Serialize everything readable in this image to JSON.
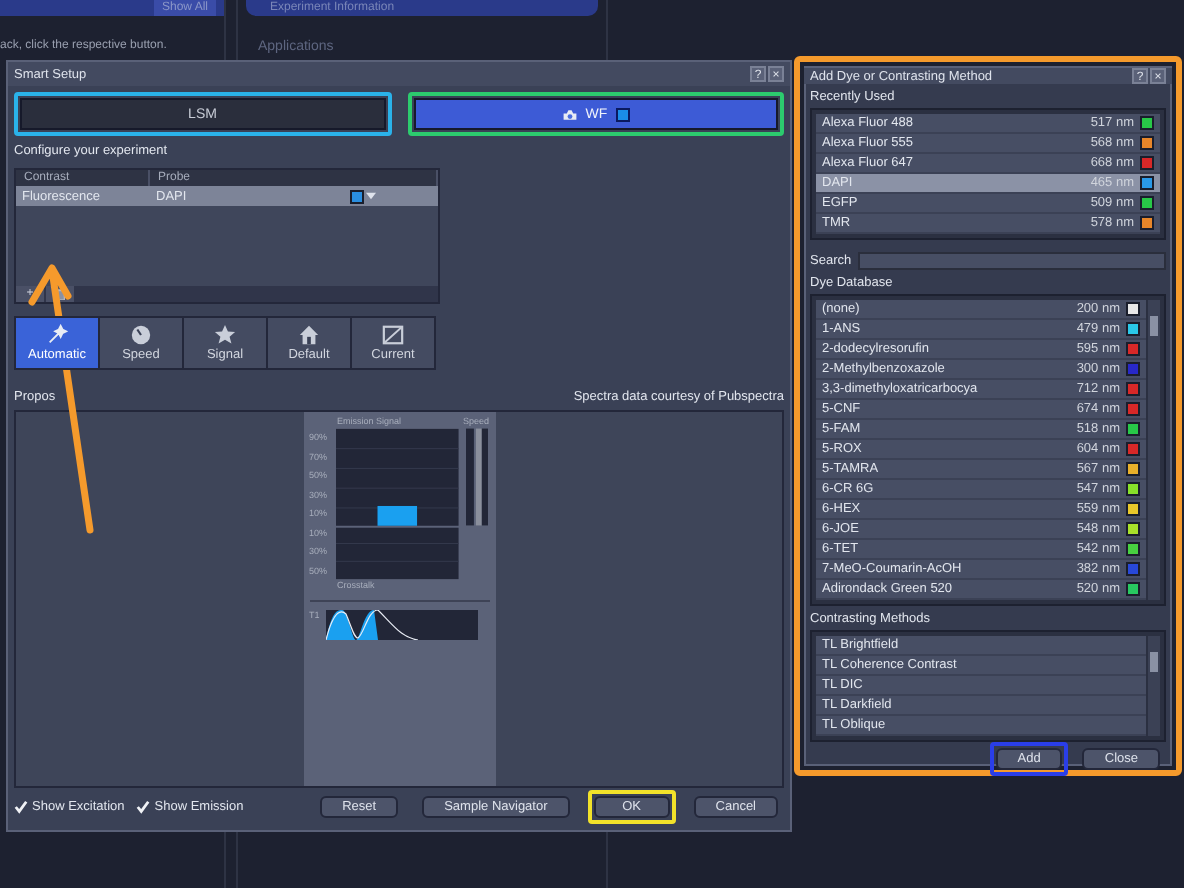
{
  "background": {
    "left_button": "Show All",
    "hint": "ack, click the respective button.",
    "section": "Experiment Information",
    "heading": "Applications"
  },
  "smart_setup": {
    "title": "Smart Setup",
    "help": "?",
    "close": "×",
    "tabs": [
      {
        "label": "LSM",
        "selected": false,
        "color": "#2ab2ea"
      },
      {
        "label": "WF",
        "selected": true,
        "color": "#2ccb6e"
      }
    ],
    "configure_label": "Configure your experiment",
    "table": {
      "columns": [
        "Contrast",
        "Probe"
      ],
      "rows": [
        {
          "contrast": "Fluorescence",
          "probe": "DAPI",
          "color": "#2a8ee0",
          "selected": true
        }
      ]
    },
    "add_row": "+",
    "modes": [
      {
        "label": "Automatic",
        "kind": "auto",
        "selected": true
      },
      {
        "label": "Speed",
        "kind": "clock",
        "selected": false
      },
      {
        "label": "Signal",
        "kind": "star",
        "selected": false
      },
      {
        "label": "Default",
        "kind": "house",
        "selected": false
      },
      {
        "label": "Current",
        "kind": "frame",
        "selected": false
      }
    ],
    "proposal_label": "Propos",
    "credit": "Spectra data courtesy of Pubspectra",
    "emission": {
      "title": "Emission Signal",
      "speed_label": "Speed",
      "ticks": [
        "90%",
        "70%",
        "50%",
        "30%",
        "10%",
        "10%",
        "30%",
        "50%"
      ],
      "crosstalk_label": "Crosstalk",
      "track": "T1"
    },
    "checkboxes": [
      {
        "label": "Show Excitation",
        "checked": true
      },
      {
        "label": "Show Emission",
        "checked": true
      }
    ],
    "buttons": [
      {
        "label": "Reset"
      },
      {
        "label": "Sample Navigator"
      },
      {
        "label": "OK",
        "color": "#f2e22a"
      },
      {
        "label": "Cancel"
      }
    ]
  },
  "add_dye": {
    "title": "Add Dye or Contrasting Method",
    "help": "?",
    "close": "×",
    "color": "#f59a2c",
    "recent_label": "Recently Used",
    "recent": [
      {
        "name": "Alexa Fluor 488",
        "wavelength": "517 nm",
        "color": "#28c848",
        "selected": false
      },
      {
        "name": "Alexa Fluor 555",
        "wavelength": "568 nm",
        "color": "#e8862a",
        "selected": false
      },
      {
        "name": "Alexa Fluor 647",
        "wavelength": "668 nm",
        "color": "#d82828",
        "selected": false
      },
      {
        "name": "DAPI",
        "wavelength": "465 nm",
        "color": "#2a9ae8",
        "selected": true
      },
      {
        "name": "EGFP",
        "wavelength": "509 nm",
        "color": "#28c848",
        "selected": false
      },
      {
        "name": "TMR",
        "wavelength": "578 nm",
        "color": "#e8862a",
        "selected": false
      }
    ],
    "search_label": "Search",
    "database_label": "Dye Database",
    "database": [
      {
        "name": "(none)",
        "wavelength": "200 nm",
        "color": "#e8e8e8"
      },
      {
        "name": "1-ANS",
        "wavelength": "479 nm",
        "color": "#2ac8e8"
      },
      {
        "name": "2-dodecylresorufin",
        "wavelength": "595 nm",
        "color": "#d82828"
      },
      {
        "name": "2-Methylbenzoxazole",
        "wavelength": "300 nm",
        "color": "#2828c8"
      },
      {
        "name": "3,3-dimethyloxatricarbocya",
        "wavelength": "712 nm",
        "color": "#d82828"
      },
      {
        "name": "5-CNF",
        "wavelength": "674 nm",
        "color": "#d82828"
      },
      {
        "name": "5-FAM",
        "wavelength": "518 nm",
        "color": "#28c848"
      },
      {
        "name": "5-ROX",
        "wavelength": "604 nm",
        "color": "#d82828"
      },
      {
        "name": "5-TAMRA",
        "wavelength": "567 nm",
        "color": "#e8b02a"
      },
      {
        "name": "6-CR 6G",
        "wavelength": "547 nm",
        "color": "#88e02a"
      },
      {
        "name": "6-HEX",
        "wavelength": "559 nm",
        "color": "#e8c82a"
      },
      {
        "name": "6-JOE",
        "wavelength": "548 nm",
        "color": "#a8e02a"
      },
      {
        "name": "6-TET",
        "wavelength": "542 nm",
        "color": "#48d040"
      },
      {
        "name": "7-MeO-Coumarin-AcOH",
        "wavelength": "382 nm",
        "color": "#2848d8"
      },
      {
        "name": "Adirondack Green 520",
        "wavelength": "520 nm",
        "color": "#28c860"
      }
    ],
    "methods_label": "Contrasting Methods",
    "methods": [
      "TL Brightfield",
      "TL Coherence Contrast",
      "TL DIC",
      "TL Darkfield",
      "TL Oblique"
    ],
    "buttons": [
      {
        "label": "Add",
        "color": "#2a3ee8"
      },
      {
        "label": "Close"
      }
    ]
  },
  "arrow": {
    "color": "#f59a2c"
  }
}
